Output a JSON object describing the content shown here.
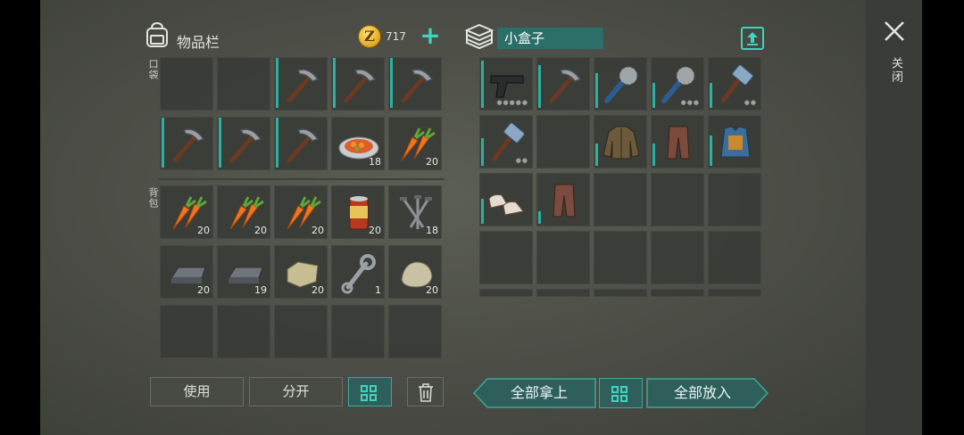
{
  "inventory": {
    "title": "物品栏",
    "coins": "717",
    "plus": "+",
    "pocket_label": "口袋",
    "backpack_label": "背包",
    "pocket_slots": [
      {
        "item": "",
        "icon": "empty"
      },
      {
        "item": "",
        "icon": "empty"
      },
      {
        "item": "pickaxe",
        "icon": "pickaxe-icon",
        "count": "",
        "bar": 1.0
      },
      {
        "item": "pickaxe",
        "icon": "pickaxe-icon",
        "count": "",
        "bar": 1.0
      },
      {
        "item": "pickaxe",
        "icon": "pickaxe-icon",
        "count": "",
        "bar": 1.0
      },
      {
        "item": "pickaxe",
        "icon": "pickaxe-icon",
        "count": "",
        "bar": 1.0
      },
      {
        "item": "pickaxe",
        "icon": "pickaxe-icon",
        "count": "",
        "bar": 1.0
      },
      {
        "item": "pickaxe",
        "icon": "pickaxe-icon",
        "count": "",
        "bar": 1.0
      },
      {
        "item": "stew",
        "icon": "carrot-stew-icon",
        "count": "18"
      },
      {
        "item": "carrot",
        "icon": "carrot-icon",
        "count": "20"
      }
    ],
    "backpack_slots": [
      {
        "item": "carrot",
        "icon": "carrot-icon",
        "count": "20"
      },
      {
        "item": "carrot",
        "icon": "carrot-icon",
        "count": "20"
      },
      {
        "item": "carrot",
        "icon": "carrot-icon",
        "count": "20"
      },
      {
        "item": "can",
        "icon": "canned-food-icon",
        "count": "20"
      },
      {
        "item": "nails",
        "icon": "nails-icon",
        "count": "18"
      },
      {
        "item": "iron-ingot",
        "icon": "iron-ingot-icon",
        "count": "20"
      },
      {
        "item": "iron-ingot",
        "icon": "iron-ingot-icon",
        "count": "19"
      },
      {
        "item": "stone-block",
        "icon": "stone-block-icon",
        "count": "20"
      },
      {
        "item": "wrench",
        "icon": "wrench-icon",
        "count": "1"
      },
      {
        "item": "rock",
        "icon": "rock-icon",
        "count": "20"
      },
      {
        "item": "",
        "icon": "empty"
      },
      {
        "item": "",
        "icon": "empty"
      },
      {
        "item": "",
        "icon": "empty"
      },
      {
        "item": "",
        "icon": "empty"
      },
      {
        "item": "",
        "icon": "empty"
      }
    ],
    "use_button": "使用",
    "split_button": "分开"
  },
  "container": {
    "name": "小盒子",
    "slots": [
      {
        "item": "pistol",
        "icon": "pistol-icon",
        "bar": 0.95,
        "dots": "●●●●●"
      },
      {
        "item": "pickaxe",
        "icon": "pickaxe-icon",
        "bar": 0.85
      },
      {
        "item": "saw-club",
        "icon": "saw-club-icon",
        "bar": 0.7
      },
      {
        "item": "saw-club",
        "icon": "saw-club-icon",
        "bar": 0.5,
        "dots": "●●●"
      },
      {
        "item": "sledgehammer",
        "icon": "sledgehammer-icon",
        "bar": 0.5,
        "dots": "●●"
      },
      {
        "item": "sledgehammer",
        "icon": "sledgehammer-icon",
        "bar": 0.55,
        "dots": "●●"
      },
      {
        "item": "",
        "icon": "empty"
      },
      {
        "item": "jacket",
        "icon": "jacket-icon",
        "bar": 0.45
      },
      {
        "item": "pants",
        "icon": "pants-icon",
        "bar": 0.45
      },
      {
        "item": "armor-vest",
        "icon": "armor-vest-icon",
        "bar": 0.6
      },
      {
        "item": "shoes",
        "icon": "shoes-icon",
        "bar": 0.5
      },
      {
        "item": "pants",
        "icon": "pants-icon",
        "bar": 0.25
      }
    ],
    "take_all_button": "全部拿上",
    "put_all_button": "全部放入"
  },
  "close_label": "关闭",
  "colors": {
    "accent": "#3fd3c0",
    "teal_dark": "#2c6f69",
    "durability": "#2bb1a1"
  }
}
